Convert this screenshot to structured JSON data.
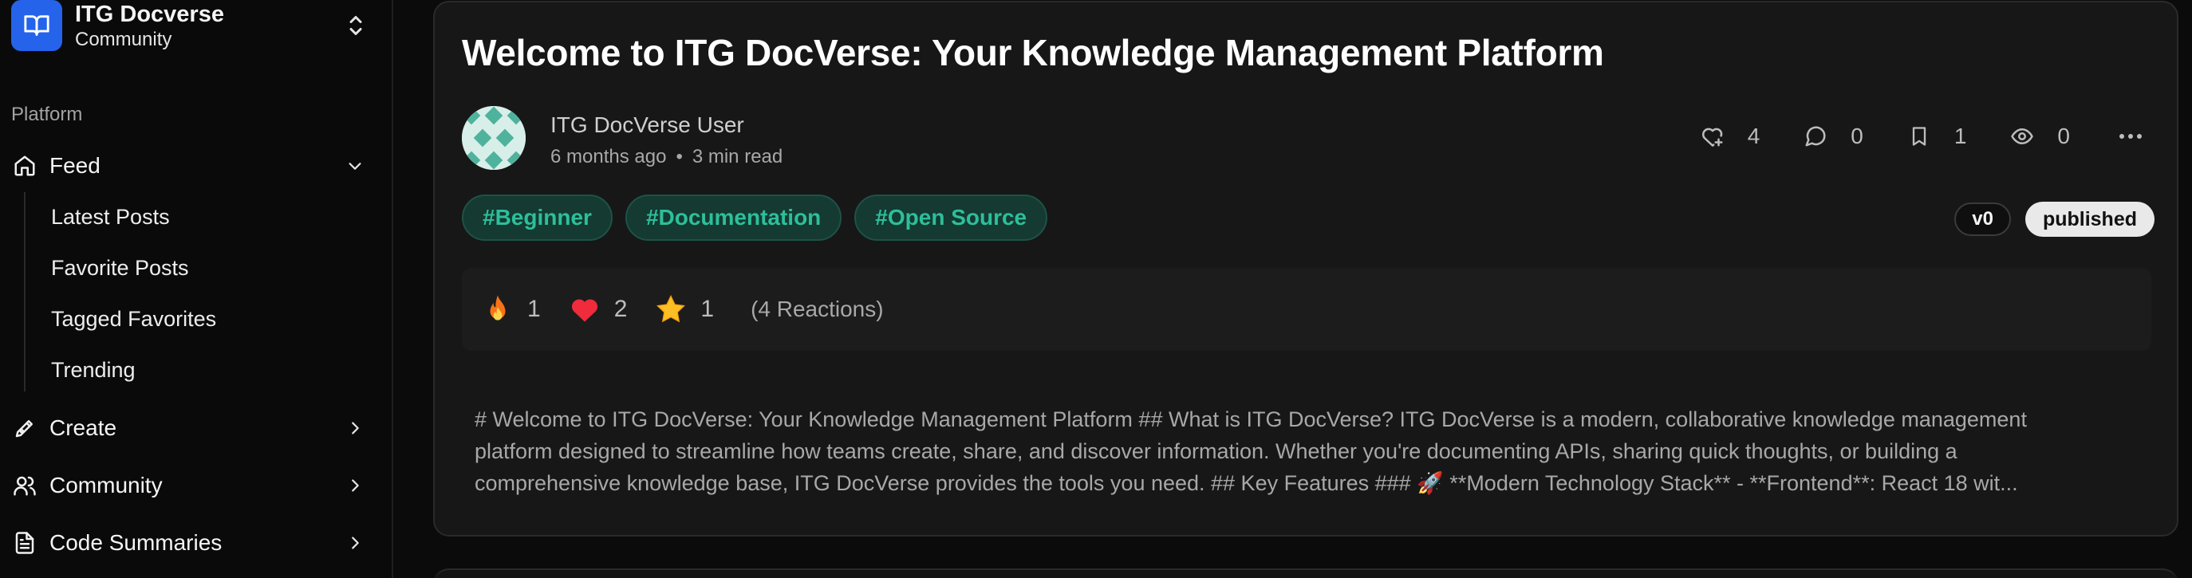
{
  "workspace": {
    "name": "ITG Docverse",
    "subtitle": "Community"
  },
  "sidebar": {
    "group_label": "Platform",
    "items": [
      {
        "label": "Feed",
        "icon": "home-icon",
        "expanded": true
      },
      {
        "label": "Create",
        "icon": "pen-icon"
      },
      {
        "label": "Community",
        "icon": "users-icon"
      },
      {
        "label": "Code Summaries",
        "icon": "file-text-icon"
      }
    ],
    "feed_subitems": [
      "Latest Posts",
      "Favorite Posts",
      "Tagged Favorites",
      "Trending"
    ]
  },
  "post": {
    "title": "Welcome to ITG DocVerse: Your Knowledge Management Platform",
    "author": "ITG DocVerse User",
    "time_ago": "6 months ago",
    "read_time": "3 min read",
    "stats": {
      "likes": "4",
      "comments": "0",
      "bookmarks": "1",
      "views": "0"
    },
    "tags": [
      "#Beginner",
      "#Documentation",
      "#Open Source"
    ],
    "version": "v0",
    "status": "published",
    "reactions": [
      {
        "emoji": "fire",
        "count": "1"
      },
      {
        "emoji": "heart",
        "count": "2"
      },
      {
        "emoji": "star",
        "count": "1"
      }
    ],
    "reactions_total": "(4 Reactions)",
    "excerpt_lines": [
      "# Welcome to ITG DocVerse: Your Knowledge Management Platform ## What is ITG DocVerse? ITG DocVerse is a modern, collaborative knowledge management",
      "platform designed to streamline how teams create, share, and discover information. Whether you're documenting APIs, sharing quick thoughts, or building a",
      "comprehensive knowledge base, ITG DocVerse provides the tools you need. ## Key Features ### 🚀 **Modern Technology Stack** - **Frontend**: React 18 wit..."
    ]
  },
  "colors": {
    "accent": "#2563eb",
    "tag_text": "#2dbf9a",
    "tag_bg": "#143a32",
    "card_bg": "#171717"
  }
}
